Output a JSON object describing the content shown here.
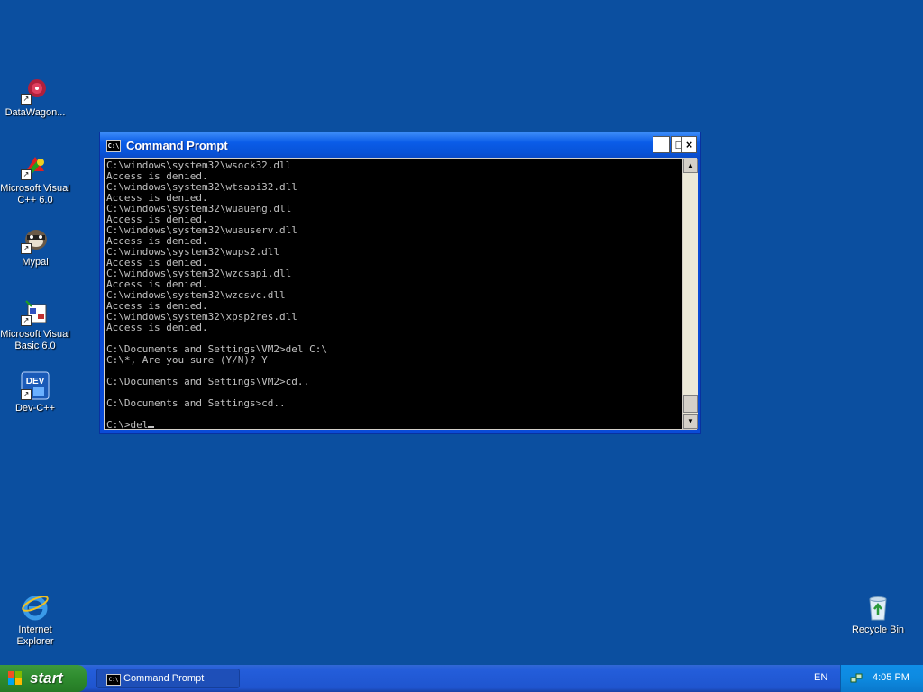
{
  "desktop": {
    "icons": [
      {
        "label": "DataWagon...",
        "icon": "datawagon-icon"
      },
      {
        "label": "Microsoft Visual C++ 6.0",
        "icon": "visual-cpp-icon"
      },
      {
        "label": "Mypal",
        "icon": "mypal-icon"
      },
      {
        "label": "Microsoft Visual Basic 6.0",
        "icon": "visual-basic-icon"
      },
      {
        "label": "Dev-C++",
        "icon": "dev-cpp-icon"
      },
      {
        "label": "Internet Explorer",
        "icon": "internet-explorer-icon"
      },
      {
        "label": "Recycle Bin",
        "icon": "recycle-bin-icon"
      }
    ],
    "dev_badge": "DEV"
  },
  "window": {
    "title": "Command Prompt",
    "icon_text": "C:\\",
    "minimize": "_",
    "maximize": "□",
    "close": "×"
  },
  "console": {
    "lines": [
      "C:\\windows\\system32\\wsock32.dll",
      "Access is denied.",
      "C:\\windows\\system32\\wtsapi32.dll",
      "Access is denied.",
      "C:\\windows\\system32\\wuaueng.dll",
      "Access is denied.",
      "C:\\windows\\system32\\wuauserv.dll",
      "Access is denied.",
      "C:\\windows\\system32\\wups2.dll",
      "Access is denied.",
      "C:\\windows\\system32\\wzcsapi.dll",
      "Access is denied.",
      "C:\\windows\\system32\\wzcsvc.dll",
      "Access is denied.",
      "C:\\windows\\system32\\xpsp2res.dll",
      "Access is denied.",
      "",
      "C:\\Documents and Settings\\VM2>del C:\\",
      "C:\\*, Are you sure (Y/N)? Y",
      "",
      "C:\\Documents and Settings\\VM2>cd..",
      "",
      "C:\\Documents and Settings>cd..",
      ""
    ],
    "prompt_line": "C:\\>del"
  },
  "scrollbar": {
    "up": "▲",
    "down": "▼"
  },
  "taskbar": {
    "start_label": "start",
    "tasks": [
      {
        "label": "Command Prompt",
        "icon_text": "C:\\"
      }
    ],
    "language": "EN",
    "clock": "4:05 PM"
  },
  "colors": {
    "desktop": "#0b4fa0",
    "titlebar": "#0a5ce8",
    "console_bg": "#000000",
    "console_fg": "#c0c0c0",
    "start_green": "#2e8b2e",
    "tray_blue": "#0d8ae0"
  }
}
